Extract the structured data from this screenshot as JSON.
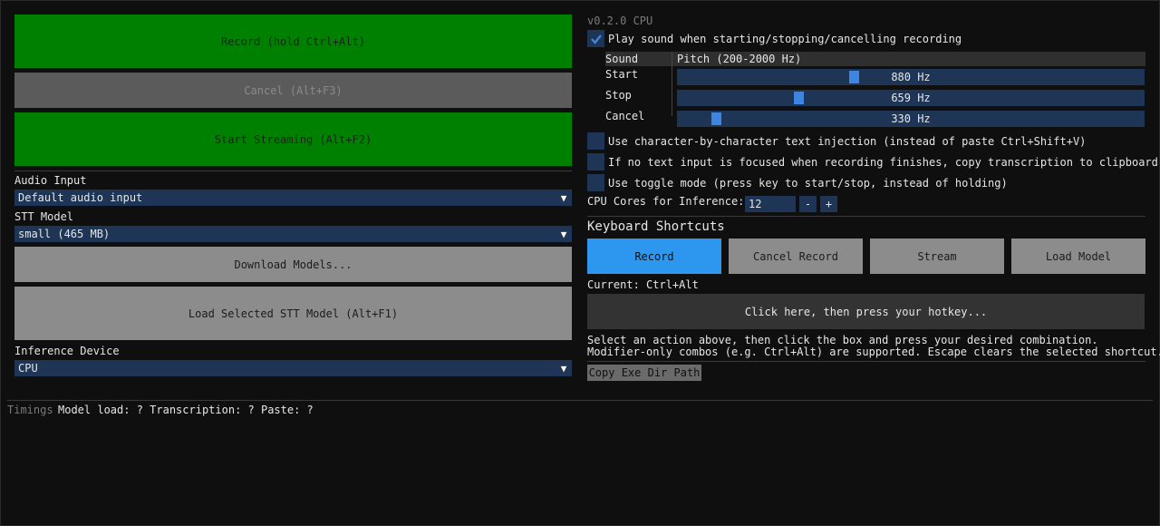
{
  "left": {
    "record_button": "Record (hold Ctrl+Alt)",
    "cancel_button": "Cancel (Alt+F3)",
    "stream_button": "Start Streaming (Alt+F2)",
    "audio_input_label": "Audio Input",
    "audio_input_value": "Default audio input",
    "stt_model_label": "STT Model",
    "stt_model_value": "small (465 MB)",
    "download_button": "Download Models...",
    "load_model_button": "Load Selected STT Model (Alt+F1)",
    "device_label": "Inference Device",
    "device_value": "CPU"
  },
  "right": {
    "version": "v0.2.0 CPU",
    "play_sound_label": "Play sound when starting/stopping/cancelling recording",
    "play_sound_checked": true,
    "sound_table": {
      "header_sound": "Sound",
      "header_pitch": "Pitch (200-2000 Hz)",
      "rows": [
        {
          "name": "Start",
          "value": "880 Hz",
          "fraction": 0.38
        },
        {
          "name": "Stop",
          "value": "659 Hz",
          "fraction": 0.26
        },
        {
          "name": "Cancel",
          "value": "330 Hz",
          "fraction": 0.08
        }
      ]
    },
    "char_injection_label": "Use character-by-character text injection (instead of paste Ctrl+Shift+V)",
    "clipboard_label": "If no text input is focused when recording finishes, copy transcription to clipboard",
    "toggle_mode_label": "Use toggle mode (press key to start/stop, instead of holding)",
    "cpu_cores_label": "CPU Cores for Inference:",
    "cpu_cores_value": "12",
    "minus": "-",
    "plus": "+",
    "shortcuts_title": "Keyboard Shortcuts",
    "shortcut_tabs": [
      "Record",
      "Cancel Record",
      "Stream",
      "Load Model"
    ],
    "current_label": "Current: Ctrl+Alt",
    "hotkey_box": "Click here, then press your hotkey...",
    "help_line1": "Select an action above, then click the box and press your desired combination.",
    "help_line2": "Modifier-only combos (e.g. Ctrl+Alt) are supported. Escape clears the selected shortcut.",
    "copy_path_button": "Copy Exe Dir Path"
  },
  "timings": {
    "label": "Timings",
    "value": "Model load: ? Transcription: ? Paste: ?"
  },
  "colors": {
    "green": "#008000",
    "blue": "#2d96ef",
    "field": "#1e3556"
  }
}
